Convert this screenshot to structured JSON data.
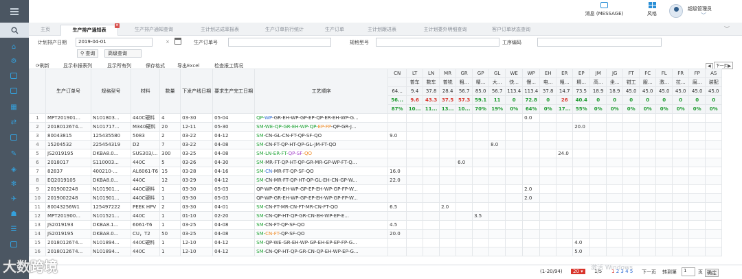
{
  "topbar": {
    "message": "消息 (MESSAGE)",
    "style": "风格",
    "user": "超级管理员",
    "user_chevron": "﹀"
  },
  "tabs": [
    {
      "label": "主页"
    },
    {
      "label": "生产排产通知表",
      "badge": "×"
    },
    {
      "label": "生产排产通知查询"
    },
    {
      "label": "主计划达成率报表"
    },
    {
      "label": "生产订单执行统计"
    },
    {
      "label": "生产订单"
    },
    {
      "label": "主计划跟进表"
    },
    {
      "label": "主计划委外明细查询"
    },
    {
      "label": "客户订单状态查询"
    }
  ],
  "tabs_more": "﹀",
  "filters": {
    "date_label": "计划排产日期",
    "date_value": "2019-04-01",
    "clear": "×",
    "order_label": "生产订单号",
    "spec_label": "规格型号",
    "process_label": "工序编码",
    "query": "查询",
    "advanced": "高级查询"
  },
  "toolbar": {
    "refresh": "刷新",
    "show_nonreport": "显示非报表列",
    "show_all": "显示所有列",
    "save_format": "保存格式",
    "export": "导出Excel",
    "check": "检查报工情况",
    "prev": "◀",
    "next": "下一页▶"
  },
  "columns": {
    "order": "生产订单号",
    "spec": "规格型号",
    "material": "材料",
    "qty": "数量",
    "issue_date": "下发产线日期",
    "req_date": "要求生产完工日期",
    "process": "工艺顺序"
  },
  "stations": [
    {
      "name": "CN",
      "cn": "",
      "total": "64...",
      "done": "56...",
      "pct": "87%"
    },
    {
      "name": "LT",
      "cn": "普车",
      "total": "9.4",
      "done": "9.6",
      "pct": "10..."
    },
    {
      "name": "LN",
      "cn": "数车",
      "total": "37.8",
      "done": "43.3",
      "pct": "11..."
    },
    {
      "name": "MR",
      "cn": "普铣",
      "total": "28.4",
      "done": "37.5",
      "pct": "13..."
    },
    {
      "name": "GR",
      "cn": "粗...",
      "total": "56.7",
      "done": "57.3",
      "pct": "10..."
    },
    {
      "name": "GP",
      "cn": "精...",
      "total": "85.0",
      "done": "59.1",
      "pct": "70%"
    },
    {
      "name": "GL",
      "cn": "大...",
      "total": "56.7",
      "done": "11",
      "pct": "19%"
    },
    {
      "name": "WE",
      "cn": "快...",
      "total": "113.4",
      "done": "0",
      "pct": "0%"
    },
    {
      "name": "WP",
      "cn": "慢...",
      "total": "113.4",
      "done": "72.8",
      "pct": "64%"
    },
    {
      "name": "EH",
      "cn": "电...",
      "total": "37.8",
      "done": "0",
      "pct": "0%"
    },
    {
      "name": "ER",
      "cn": "粗...",
      "total": "14.7",
      "done": "26",
      "pct": "17..."
    },
    {
      "name": "EP",
      "cn": "精...",
      "total": "73.5",
      "done": "40.4",
      "pct": "55%"
    },
    {
      "name": "JM",
      "cn": "高...",
      "total": "18.9",
      "done": "0",
      "pct": "0%"
    },
    {
      "name": "JG",
      "cn": "坐...",
      "total": "18.9",
      "done": "0",
      "pct": "0%"
    },
    {
      "name": "FT",
      "cn": "钳工",
      "total": "45.0",
      "done": "0",
      "pct": "0%"
    },
    {
      "name": "FC",
      "cn": "服...",
      "total": "45.0",
      "done": "0",
      "pct": "0%"
    },
    {
      "name": "FL",
      "cn": "激...",
      "total": "45.0",
      "done": "0",
      "pct": "0%"
    },
    {
      "name": "FR",
      "cn": "拉...",
      "total": "45.0",
      "done": "0",
      "pct": "0%"
    },
    {
      "name": "FP",
      "cn": "腐...",
      "total": "45.0",
      "done": "0",
      "pct": "0%"
    },
    {
      "name": "AS",
      "cn": "装配",
      "total": "45.0",
      "done": "0",
      "pct": "0%"
    }
  ],
  "rows": [
    {
      "n": "1",
      "order": "MPT201901...",
      "spec": "N101803...",
      "mat": "440C硬料",
      "qty": "4",
      "d1": "03-30",
      "d2": "05-04",
      "proc": [
        [
          "QP-",
          "g"
        ],
        [
          "WP",
          "b"
        ],
        [
          "-GR-EH-WP-GP-EP-QP-ER-EH-WP-G...",
          "k"
        ]
      ],
      "vals": {
        "8": "0.0"
      }
    },
    {
      "n": "2",
      "order": "2018012674...",
      "spec": "N101717...",
      "mat": "M340硬料",
      "qty": "20",
      "d1": "12-11",
      "d2": "05-30",
      "proc": [
        [
          "SM-WE-QP-GR-EH-WP-QP-",
          "g"
        ],
        [
          "EP-FP",
          "o"
        ],
        [
          "-QP-GR-J...",
          "k"
        ]
      ],
      "vals": {
        "11": "20.0"
      }
    },
    {
      "n": "3",
      "order": "80043815",
      "spec": "125435580",
      "mat": "5083",
      "qty": "2",
      "d1": "03-22",
      "d2": "04-12",
      "proc": [
        [
          "SM-",
          "g"
        ],
        [
          "CN-GL-CN-FT-QP-SF-QO",
          "k"
        ]
      ],
      "vals": {
        "0": "9.0"
      }
    },
    {
      "n": "4",
      "order": "15204532",
      "spec": "225454319",
      "mat": "D2",
      "qty": "7",
      "d1": "03-22",
      "d2": "04-08",
      "proc": [
        [
          "SM-",
          "g"
        ],
        [
          "CN-FT-QP-HT-QP-GL-JM-FT-QO",
          "k"
        ]
      ],
      "vals": {
        "6": "8.0"
      }
    },
    {
      "n": "5",
      "order": "JS2019195",
      "spec": "DKBA8.0...",
      "mat": "SUS303/...",
      "qty": "300",
      "d1": "03-25",
      "d2": "04-08",
      "proc": [
        [
          "SM-LN-ER-FT-",
          "g"
        ],
        [
          "QP-SF",
          "m"
        ],
        [
          "-QO",
          "o"
        ]
      ],
      "vals": {
        "10": "24.0"
      }
    },
    {
      "n": "6",
      "order": "2018017",
      "spec": "S110003...",
      "mat": "440C",
      "qty": "5",
      "d1": "03-26",
      "d2": "04-30",
      "proc": [
        [
          "SM-",
          "g"
        ],
        [
          "MR-FT-QP-HT-QP-GR-MR-GP-WP-FT-Q...",
          "k"
        ]
      ],
      "vals": {
        "4": "6.0"
      }
    },
    {
      "n": "7",
      "order": "82837",
      "spec": "400210-...",
      "mat": "AL6061-T6",
      "qty": "15",
      "d1": "03-28",
      "d2": "04-16",
      "proc": [
        [
          "SM-",
          "g"
        ],
        [
          "CN",
          "b"
        ],
        [
          "-MR-FT-QP-SF-QO",
          "k"
        ]
      ],
      "vals": {
        "0": "16.0"
      }
    },
    {
      "n": "8",
      "order": "EQ2019105",
      "spec": "DKBA8.0...",
      "mat": "440C",
      "qty": "12",
      "d1": "03-29",
      "d2": "04-12",
      "proc": [
        [
          "SM-",
          "g"
        ],
        [
          "CN-MR-FT-QP-HT-QP-GL-EH-CN-GP-W...",
          "k"
        ]
      ],
      "vals": {
        "0": "22.0"
      }
    },
    {
      "n": "9",
      "order": "2019002248",
      "spec": "N101901...",
      "mat": "440C硬料",
      "qty": "1",
      "d1": "03-30",
      "d2": "05-03",
      "proc": [
        [
          "QP-WP-GR-EH-WP-GP-EP-EH-WP-GP-FP-W...",
          "k"
        ]
      ],
      "vals": {
        "8": "2.0"
      }
    },
    {
      "n": "10",
      "order": "2019002248",
      "spec": "N101901...",
      "mat": "440C硬料",
      "qty": "1",
      "d1": "03-30",
      "d2": "05-03",
      "proc": [
        [
          "QP-WP-GR-EH-WP-GP-EP-EH-WP-GP-FP-W...",
          "k"
        ]
      ],
      "vals": {
        "8": "2.0"
      }
    },
    {
      "n": "11",
      "order": "80043256W1",
      "spec": "125497222",
      "mat": "PEEK HPV",
      "qty": "2",
      "d1": "03-30",
      "d2": "04-01",
      "proc": [
        [
          "SM-",
          "g"
        ],
        [
          "CN-FT-MR-CN-FT-MR-CN-FT-QO",
          "k"
        ]
      ],
      "vals": {
        "0": "6.5",
        "3": "2.0"
      }
    },
    {
      "n": "12",
      "order": "MPT201900...",
      "spec": "N101521...",
      "mat": "440C",
      "qty": "1",
      "d1": "01-10",
      "d2": "02-20",
      "proc": [
        [
          "SM-",
          "g"
        ],
        [
          "CN-QP-HT-QP-GR-CN-EH-WP-EP-E...",
          "k"
        ]
      ],
      "vals": {
        "5": "3.5"
      }
    },
    {
      "n": "13",
      "order": "JS2019193",
      "spec": "DKBA8.1...",
      "mat": "6061-T6",
      "qty": "1",
      "d1": "03-25",
      "d2": "04-08",
      "proc": [
        [
          "SM-",
          "g"
        ],
        [
          "CN-FT-QP-SF-QO",
          "k"
        ]
      ],
      "vals": {
        "0": "4.5"
      }
    },
    {
      "n": "14",
      "order": "JS2019195",
      "spec": "DKBA8.0...",
      "mat": "CU，T2",
      "qty": "50",
      "d1": "03-25",
      "d2": "04-08",
      "proc": [
        [
          "SM-",
          "g"
        ],
        [
          "CN-FT",
          "o"
        ],
        [
          "-QP-SF-QO",
          "k"
        ]
      ],
      "vals": {
        "0": "20.0"
      }
    },
    {
      "n": "15",
      "order": "2018012674...",
      "spec": "N101894...",
      "mat": "440C硬料",
      "qty": "1",
      "d1": "12-10",
      "d2": "04-12",
      "proc": [
        [
          "SM-",
          "g"
        ],
        [
          "QP-WE-GR-EH-WP-GP-EH-EP-EP-FP-G...",
          "k"
        ]
      ],
      "vals": {
        "11": "4.0"
      }
    },
    {
      "n": "16",
      "order": "2018012674...",
      "spec": "N101894...",
      "mat": "440C",
      "qty": "1",
      "d1": "12-10",
      "d2": "04-12",
      "proc": [
        [
          "SM-",
          "g"
        ],
        [
          "CN-QP-HT-QP-GR-CN-QP-EH-WP-EP-G...",
          "k"
        ]
      ],
      "vals": {
        "11": "5.0"
      }
    }
  ],
  "footer": {
    "range": "(1-20/94)",
    "per_page": "20 ▾",
    "page_info": "1/5",
    "pages": [
      "1",
      "2",
      "3",
      "4",
      "5"
    ],
    "next": "下一页",
    "jump": "转到第",
    "jump_value": "1",
    "page_unit": "页",
    "confirm": "确定"
  },
  "watermark": "大数跨境",
  "win_activate": "激活 Windows"
}
